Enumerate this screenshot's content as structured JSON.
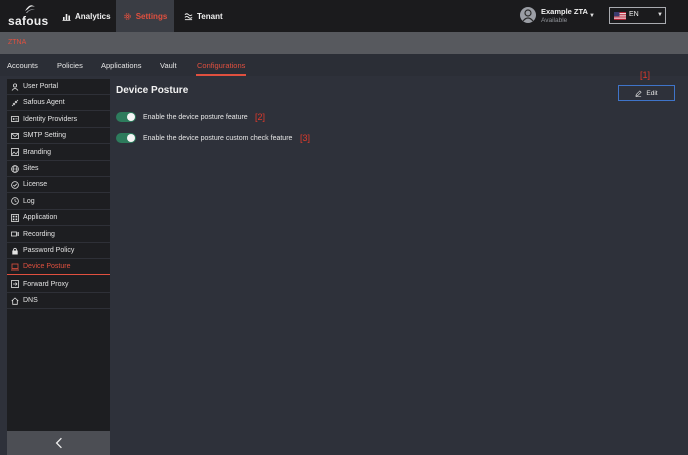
{
  "topbar": {
    "logo_text": "safous",
    "nav": [
      {
        "label": "Analytics",
        "icon": "bar-chart-icon"
      },
      {
        "label": "Settings",
        "icon": "gear-icon",
        "active": true
      },
      {
        "label": "Tenant",
        "icon": "tenant-icon"
      }
    ],
    "user": {
      "name": "Example ZTA",
      "status": "Available"
    },
    "language": {
      "code": "EN",
      "flag": "us-flag-icon"
    }
  },
  "subbar": {
    "title": "ZTNA"
  },
  "tabs": [
    {
      "label": "Accounts"
    },
    {
      "label": "Policies"
    },
    {
      "label": "Applications"
    },
    {
      "label": "Vault"
    },
    {
      "label": "Configurations",
      "active": true
    }
  ],
  "sidebar": {
    "items": [
      {
        "label": "User Portal",
        "icon": "user-icon"
      },
      {
        "label": "Safous Agent",
        "icon": "agent-icon"
      },
      {
        "label": "Identity Providers",
        "icon": "id-card-icon"
      },
      {
        "label": "SMTP Setting",
        "icon": "mail-icon"
      },
      {
        "label": "Branding",
        "icon": "image-icon"
      },
      {
        "label": "Sites",
        "icon": "globe-icon"
      },
      {
        "label": "License",
        "icon": "badge-check-icon"
      },
      {
        "label": "Log",
        "icon": "clock-icon"
      },
      {
        "label": "Application",
        "icon": "grid-icon"
      },
      {
        "label": "Recording",
        "icon": "video-icon"
      },
      {
        "label": "Password Policy",
        "icon": "lock-icon"
      },
      {
        "label": "Device Posture",
        "icon": "laptop-icon",
        "active": true
      },
      {
        "label": "Forward Proxy",
        "icon": "proxy-icon"
      },
      {
        "label": "DNS",
        "icon": "home-icon"
      }
    ],
    "collapse_icon": "chevron-left-icon"
  },
  "main": {
    "title": "Device Posture",
    "edit_label": "Edit",
    "toggles": [
      {
        "label": "Enable the device posture feature",
        "enabled": true
      },
      {
        "label": "Enable the device posture custom check feature",
        "enabled": true
      }
    ]
  },
  "annotations": [
    "[1]",
    "[2]",
    "[3]"
  ],
  "colors": {
    "accent": "#e0503f",
    "toggle_on": "#2d7b5c",
    "edit_border": "#3f74c9",
    "annotation": "#e0392b"
  }
}
